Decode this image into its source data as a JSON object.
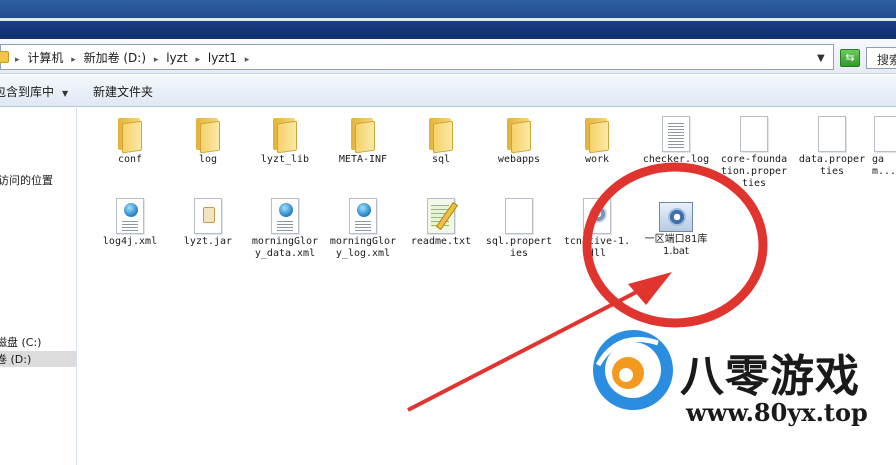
{
  "address": {
    "crumbs": [
      "计算机",
      "新加卷 (D:)",
      "lyzt",
      "lyzt1"
    ],
    "search_placeholder": "搜索"
  },
  "toolbar": {
    "include_library": "包含到库中",
    "new_folder": "新建文件夹"
  },
  "sidebar": {
    "recent_places": "访问的位置",
    "drive_c": "磁盘 (C:)",
    "drive_d": "卷 (D:)"
  },
  "files": [
    {
      "name": "conf",
      "type": "folder"
    },
    {
      "name": "log",
      "type": "folder"
    },
    {
      "name": "lyzt_lib",
      "type": "folder"
    },
    {
      "name": "META-INF",
      "type": "folder"
    },
    {
      "name": "sql",
      "type": "folder"
    },
    {
      "name": "webapps",
      "type": "folder"
    },
    {
      "name": "work",
      "type": "folder"
    },
    {
      "name": "checker.log",
      "type": "doc"
    },
    {
      "name": "core-foundation.properties",
      "type": "blank"
    },
    {
      "name": "data.properties",
      "type": "blank"
    },
    {
      "name": "gam...",
      "type": "blank"
    },
    {
      "name": "log4j.xml",
      "type": "xml"
    },
    {
      "name": "lyzt.jar",
      "type": "jar"
    },
    {
      "name": "morningGlory_data.xml",
      "type": "xml"
    },
    {
      "name": "morningGlory_log.xml",
      "type": "xml"
    },
    {
      "name": "readme.txt",
      "type": "txt"
    },
    {
      "name": "sql.properties",
      "type": "blank"
    },
    {
      "name": "tcnative-1.dll",
      "type": "dll"
    },
    {
      "name": "一区端口81库1.bat",
      "type": "bat"
    }
  ],
  "watermark": {
    "brand": "八零游戏",
    "url": "www.80yx.top"
  },
  "annotation_color": "#e0342f"
}
